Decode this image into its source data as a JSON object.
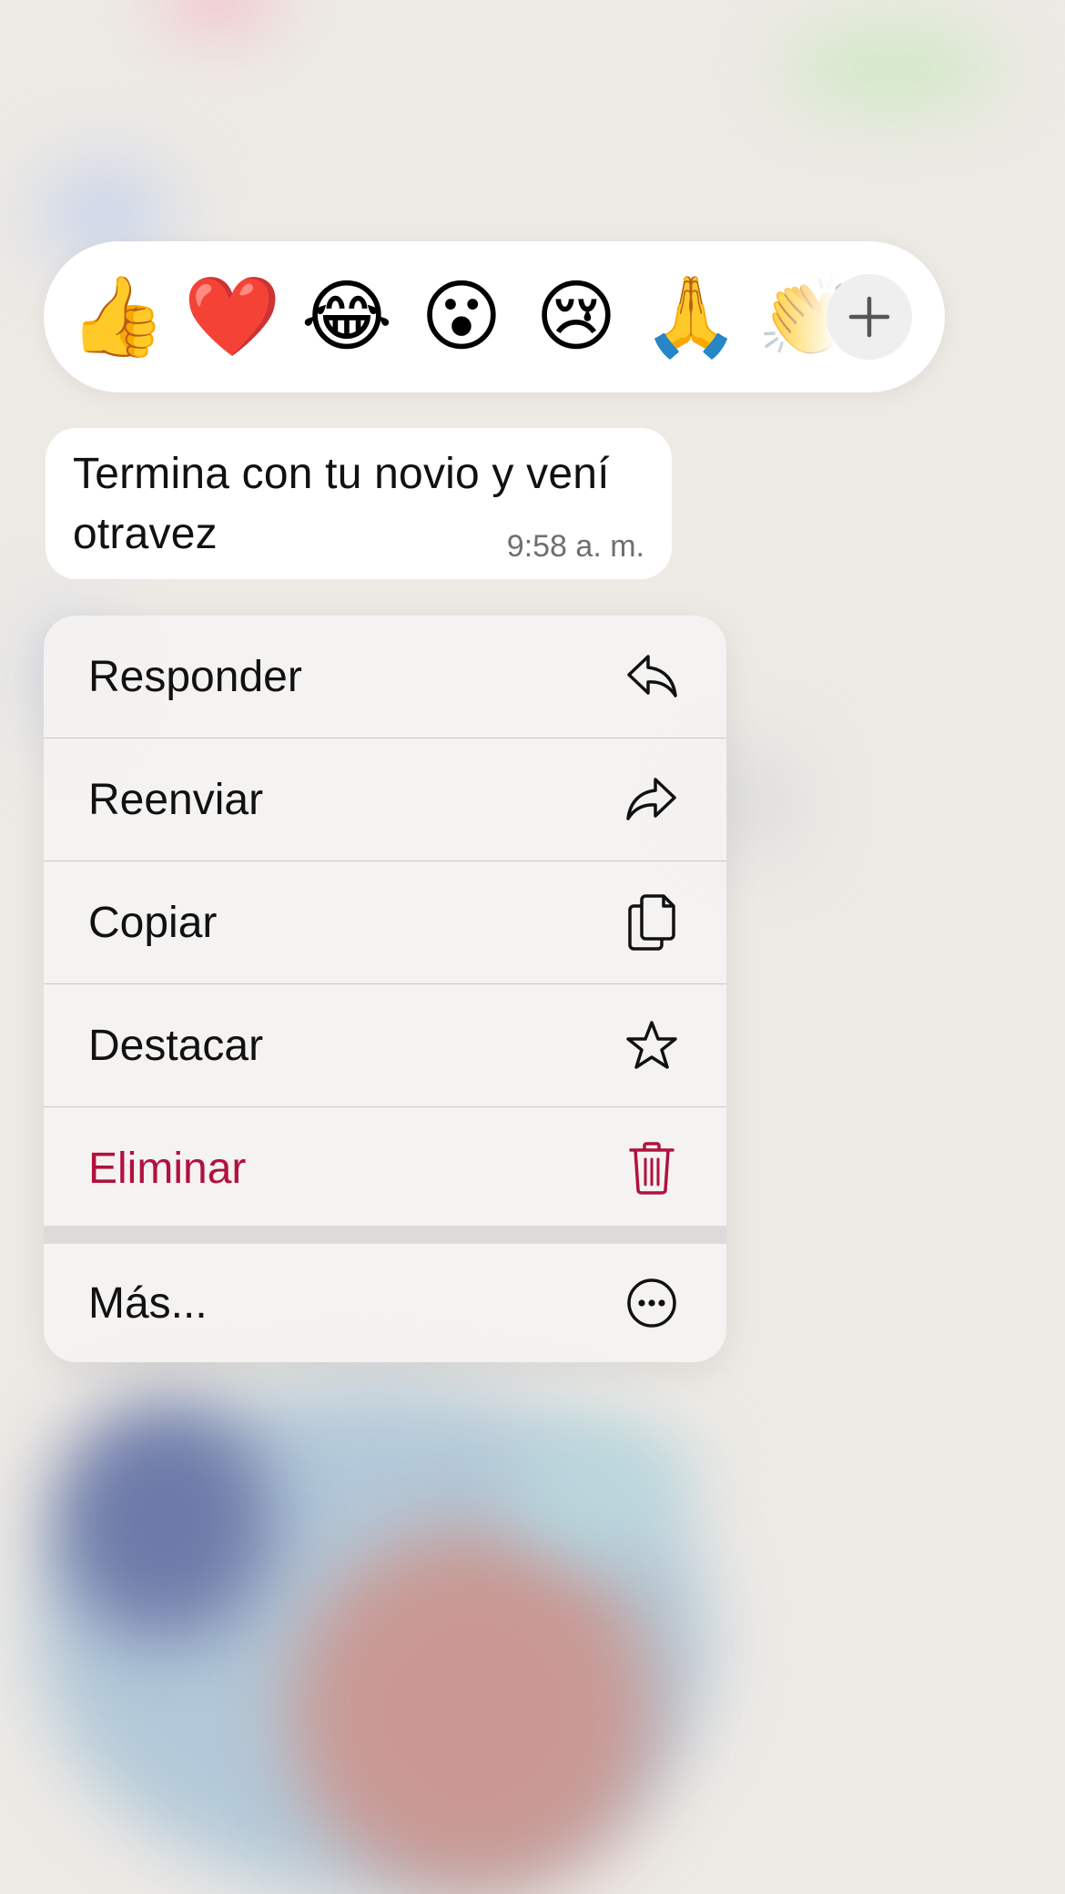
{
  "reactions": {
    "emojis": [
      "👍",
      "❤️",
      "😂",
      "😮",
      "😢",
      "🙏",
      "👏"
    ],
    "more_icon": "plus-icon"
  },
  "message": {
    "text": "Termina con tu novio y vení otravez",
    "time": "9:58 a. m."
  },
  "menu": {
    "items": [
      {
        "label": "Responder",
        "icon": "reply-icon"
      },
      {
        "label": "Reenviar",
        "icon": "forward-icon"
      },
      {
        "label": "Copiar",
        "icon": "copy-icon"
      },
      {
        "label": "Destacar",
        "icon": "star-icon"
      },
      {
        "label": "Eliminar",
        "icon": "trash-icon"
      },
      {
        "label": "Más...",
        "icon": "more-icon"
      }
    ]
  },
  "colors": {
    "danger": "#b0123e",
    "background": "#edeae5"
  }
}
